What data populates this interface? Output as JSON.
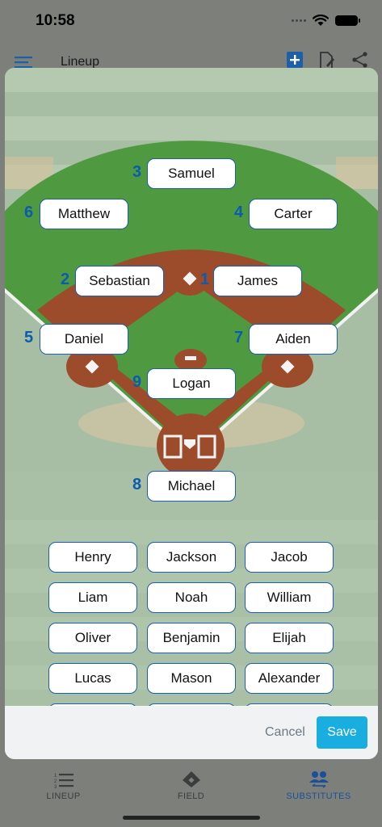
{
  "status_bar": {
    "time": "10:58"
  },
  "nav": {
    "title": "Lineup"
  },
  "positions": [
    {
      "number": "3",
      "player": "Samuel"
    },
    {
      "number": "6",
      "player": "Matthew"
    },
    {
      "number": "4",
      "player": "Carter"
    },
    {
      "number": "2",
      "player": "Sebastian"
    },
    {
      "number": "1",
      "player": "James"
    },
    {
      "number": "5",
      "player": "Daniel"
    },
    {
      "number": "7",
      "player": "Aiden"
    },
    {
      "number": "9",
      "player": "Logan"
    },
    {
      "number": "8",
      "player": "Michael"
    }
  ],
  "substitutes": [
    "Henry",
    "Jackson",
    "Jacob",
    "Liam",
    "Noah",
    "William",
    "Oliver",
    "Benjamin",
    "Elijah",
    "Lucas",
    "Mason",
    "Alexander"
  ],
  "footer": {
    "cancel_label": "Cancel",
    "save_label": "Save"
  },
  "tabs": [
    {
      "label": "LINEUP",
      "icon": "numbered-list-icon",
      "active": false
    },
    {
      "label": "FIELD",
      "icon": "baseball-diamond-icon",
      "active": false
    },
    {
      "label": "SUBSTITUTES",
      "icon": "people-swap-icon",
      "active": true
    }
  ],
  "colors": {
    "accent": "#1d5fa8",
    "save": "#1aaee0",
    "grass": "#4d9a3f",
    "dirt": "#9c4b2b",
    "position_number": "#0b5cad"
  }
}
